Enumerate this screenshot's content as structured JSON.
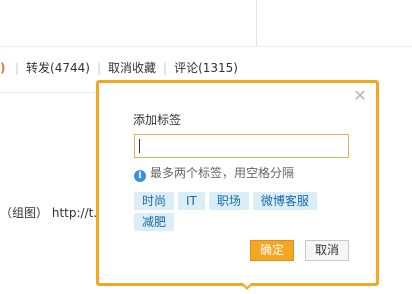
{
  "action_bar": {
    "repost": "转发(4744)",
    "uncollect": "取消收藏",
    "comment": "评论(1315)"
  },
  "post": {
    "text_prefix": "（组图）",
    "link_text": "http://t.cn"
  },
  "dialog": {
    "title": "添加标签",
    "input_value": "",
    "hint": "最多两个标签，用空格分隔",
    "tags": [
      "时尚",
      "IT",
      "职场",
      "微博客服",
      "减肥"
    ],
    "ok_label": "确定",
    "cancel_label": "取消",
    "close_icon": "close-icon"
  },
  "colors": {
    "accent": "#f5a623",
    "tag_bg": "#dbeef8",
    "tag_text": "#1c6aa6",
    "info": "#3a8ede"
  }
}
